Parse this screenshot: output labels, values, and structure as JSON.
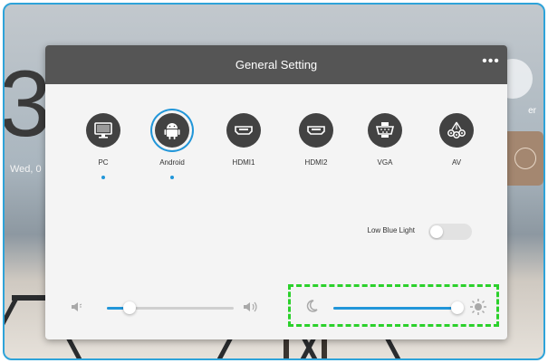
{
  "background": {
    "clock_digit": "3",
    "date_text": "Wed, 0",
    "right_label": "er"
  },
  "dialog": {
    "title": "General Setting",
    "more_label": "•••"
  },
  "sources": [
    {
      "label": "PC",
      "icon": "monitor-icon",
      "selected_dot": true
    },
    {
      "label": "Android",
      "icon": "android-icon",
      "selected_dot": true,
      "active": true
    },
    {
      "label": "HDMI1",
      "icon": "hdmi-icon"
    },
    {
      "label": "HDMI2",
      "icon": "hdmi-icon"
    },
    {
      "label": "VGA",
      "icon": "vga-icon"
    },
    {
      "label": "AV",
      "icon": "av-icon"
    }
  ],
  "low_blue_light": {
    "label": "Low Blue Light",
    "enabled": false
  },
  "volume": {
    "level": 0.18,
    "icon_low": "volume-low-icon",
    "icon_high": "volume-high-icon"
  },
  "brightness": {
    "level": 0.98,
    "icon_low": "moon-icon",
    "icon_high": "sun-icon"
  },
  "colors": {
    "accent": "#2196d9",
    "header": "#555555",
    "frame": "#2ea3d9",
    "highlight": "#2bd12b"
  }
}
